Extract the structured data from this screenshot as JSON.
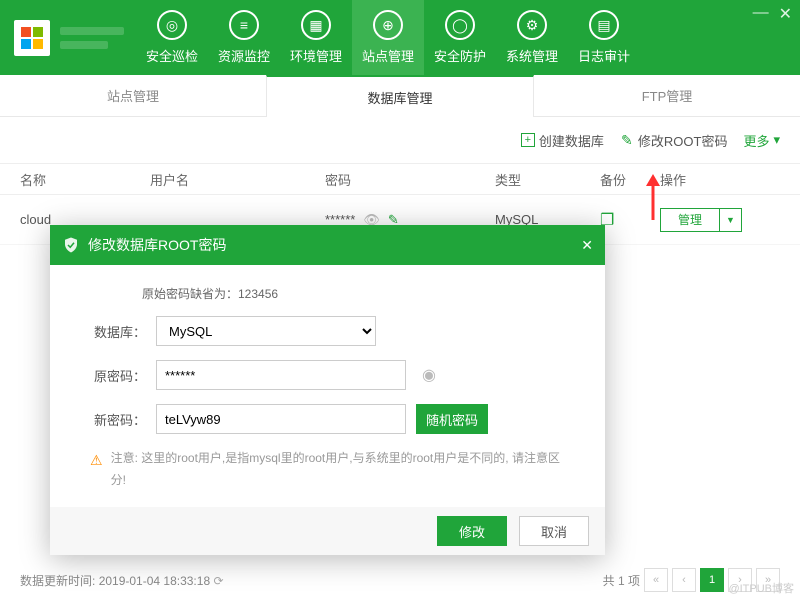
{
  "header": {
    "nav": [
      {
        "label": "安全巡检",
        "icon": "◎"
      },
      {
        "label": "资源监控",
        "icon": "≡"
      },
      {
        "label": "环境管理",
        "icon": "▦"
      },
      {
        "label": "站点管理",
        "icon": "⊕",
        "active": true
      },
      {
        "label": "安全防护",
        "icon": "◯"
      },
      {
        "label": "系统管理",
        "icon": "⚙"
      },
      {
        "label": "日志审计",
        "icon": "▤"
      }
    ]
  },
  "subtabs": [
    "站点管理",
    "数据库管理",
    "FTP管理"
  ],
  "subtab_active": 1,
  "toolbar": {
    "create_db": "创建数据库",
    "mod_root": "修改ROOT密码",
    "more": "更多"
  },
  "table": {
    "columns": {
      "name": "名称",
      "user": "用户名",
      "pass": "密码",
      "type": "类型",
      "backup": "备份",
      "action": "操作"
    },
    "rows": [
      {
        "name": "cloud",
        "user": "",
        "pass": "******",
        "type": "MySQL",
        "action": "管理"
      }
    ]
  },
  "footer": {
    "update_label": "数据更新时间:",
    "update_time": "2019-01-04 18:33:18",
    "total_label": "共 1 项",
    "page": "1"
  },
  "modal": {
    "title": "修改数据库ROOT密码",
    "default_hint": "原始密码缺省为：123456",
    "db_label": "数据库：",
    "db_value": "MySQL",
    "old_label": "原密码：",
    "old_value": "******",
    "new_label": "新密码：",
    "new_value": "teLVyw89",
    "random_btn": "随机密码",
    "note": "注意: 这里的root用户,是指mysql里的root用户,与系统里的root用户是不同的, 请注意区分!",
    "ok": "修改",
    "cancel": "取消"
  },
  "watermark": "@ITPUB博客"
}
